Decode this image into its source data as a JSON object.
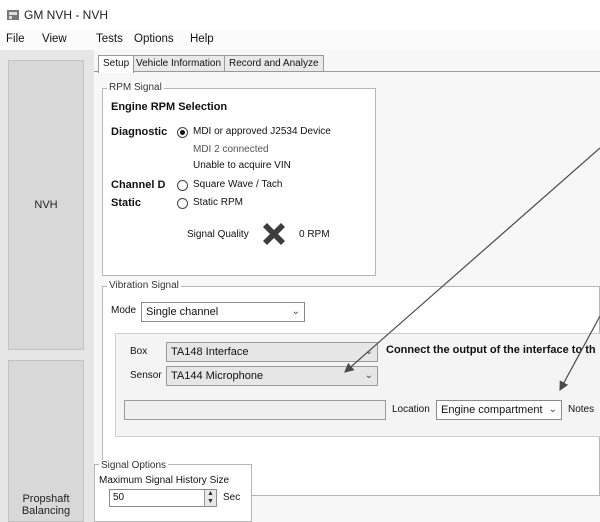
{
  "window": {
    "title": "GM NVH - NVH"
  },
  "menu": {
    "file": "File",
    "view": "View",
    "tests": "Tests",
    "options": "Options",
    "help": "Help"
  },
  "sidebar": {
    "nvh": "NVH",
    "propshaft_line1": "Propshaft",
    "propshaft_line2": "Balancing"
  },
  "tabs": {
    "setup": "Setup",
    "vehicle_information": "Vehicle Information",
    "record_and_analyze": "Record and Analyze"
  },
  "rpm_signal": {
    "group_title": "RPM Signal",
    "heading": "Engine RPM Selection",
    "diagnostic_label": "Diagnostic",
    "diagnostic_option": "MDI or approved J2534 Device",
    "mdi_status": "MDI 2 connected",
    "vin_status": "Unable to acquire VIN",
    "channel_d_label": "Channel D",
    "channel_d_option": "Square Wave / Tach",
    "static_label": "Static",
    "static_option": "Static RPM",
    "signal_quality_label": "Signal Quality",
    "rpm_value": "0 RPM",
    "selected_option": "diagnostic"
  },
  "vibration_signal": {
    "group_title": "Vibration Signal",
    "mode_label": "Mode",
    "mode_value": "Single channel",
    "box_label": "Box",
    "box_value": "TA148 Interface",
    "sensor_label": "Sensor",
    "sensor_value": "TA144 Microphone",
    "connect_note": "Connect the output of the interface to th",
    "location_label": "Location",
    "location_value": "Engine compartment",
    "notes_label": "Notes"
  },
  "signal_options": {
    "group_title": "Signal Options",
    "history_label": "Maximum Signal History Size",
    "history_value": "50",
    "history_unit": "Sec"
  },
  "colors": {
    "window_bg": "#f2f2f2",
    "panel_bg": "#ffffff",
    "nav_button": "#d8d8d8",
    "annotation_line": "#4a4a4a"
  }
}
